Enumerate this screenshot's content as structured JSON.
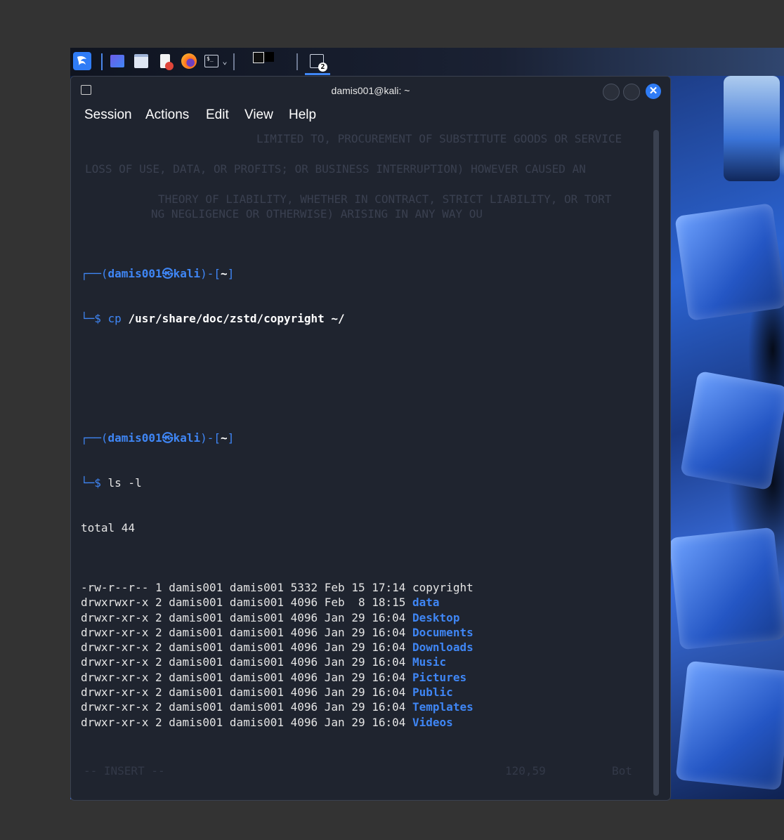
{
  "taskbar": {
    "workspace_badge": "2"
  },
  "window": {
    "title": "damis001@kali: ~"
  },
  "menu": [
    "Session",
    "Actions",
    "Edit",
    "View",
    "Help"
  ],
  "terminal": {
    "prompt_user": "damis001",
    "prompt_at": "㉿",
    "prompt_host": "kali",
    "prompt_dir": "~",
    "cmd1_name": "cp",
    "cmd1_args": "/usr/share/doc/zstd/copyright ~/",
    "cmd2": "ls -l",
    "total": "total 44",
    "listing": [
      {
        "meta": "-rw-r--r-- 1 damis001 damis001 5332 Feb 15 17:14 ",
        "name": "copyright",
        "dir": false
      },
      {
        "meta": "drwxrwxr-x 2 damis001 damis001 4096 Feb  8 18:15 ",
        "name": "data",
        "dir": true
      },
      {
        "meta": "drwxr-xr-x 2 damis001 damis001 4096 Jan 29 16:04 ",
        "name": "Desktop",
        "dir": true
      },
      {
        "meta": "drwxr-xr-x 2 damis001 damis001 4096 Jan 29 16:04 ",
        "name": "Documents",
        "dir": true
      },
      {
        "meta": "drwxr-xr-x 2 damis001 damis001 4096 Jan 29 16:04 ",
        "name": "Downloads",
        "dir": true
      },
      {
        "meta": "drwxr-xr-x 2 damis001 damis001 4096 Jan 29 16:04 ",
        "name": "Music",
        "dir": true
      },
      {
        "meta": "drwxr-xr-x 2 damis001 damis001 4096 Jan 29 16:04 ",
        "name": "Pictures",
        "dir": true
      },
      {
        "meta": "drwxr-xr-x 2 damis001 damis001 4096 Jan 29 16:04 ",
        "name": "Public",
        "dir": true
      },
      {
        "meta": "drwxr-xr-x 2 damis001 damis001 4096 Jan 29 16:04 ",
        "name": "Templates",
        "dir": true
      },
      {
        "meta": "drwxr-xr-x 2 damis001 damis001 4096 Jan 29 16:04 ",
        "name": "Videos",
        "dir": true
      }
    ],
    "ghost_lines": [
      "LIMITED TO, PROCUREMENT OF SUBSTITUTE GOODS OR SERVICE",
      "LOSS OF USE, DATA, OR PROFITS; OR BUSINESS INTERRUPTION) HOWEVER CAUSED AN",
      "THEORY OF LIABILITY, WHETHER IN CONTRACT, STRICT LIABILITY, OR TORT",
      "NG NEGLIGENCE OR OTHERWISE) ARISING IN ANY WAY OU"
    ],
    "ghost_status_mode": "-- INSERT --",
    "ghost_status_pos": "120,59",
    "ghost_status_pct": "Bot"
  },
  "colors": {
    "accent": "#3f86f5",
    "close_button": "#2f7cf6",
    "terminal_bg": "#1f242f"
  }
}
